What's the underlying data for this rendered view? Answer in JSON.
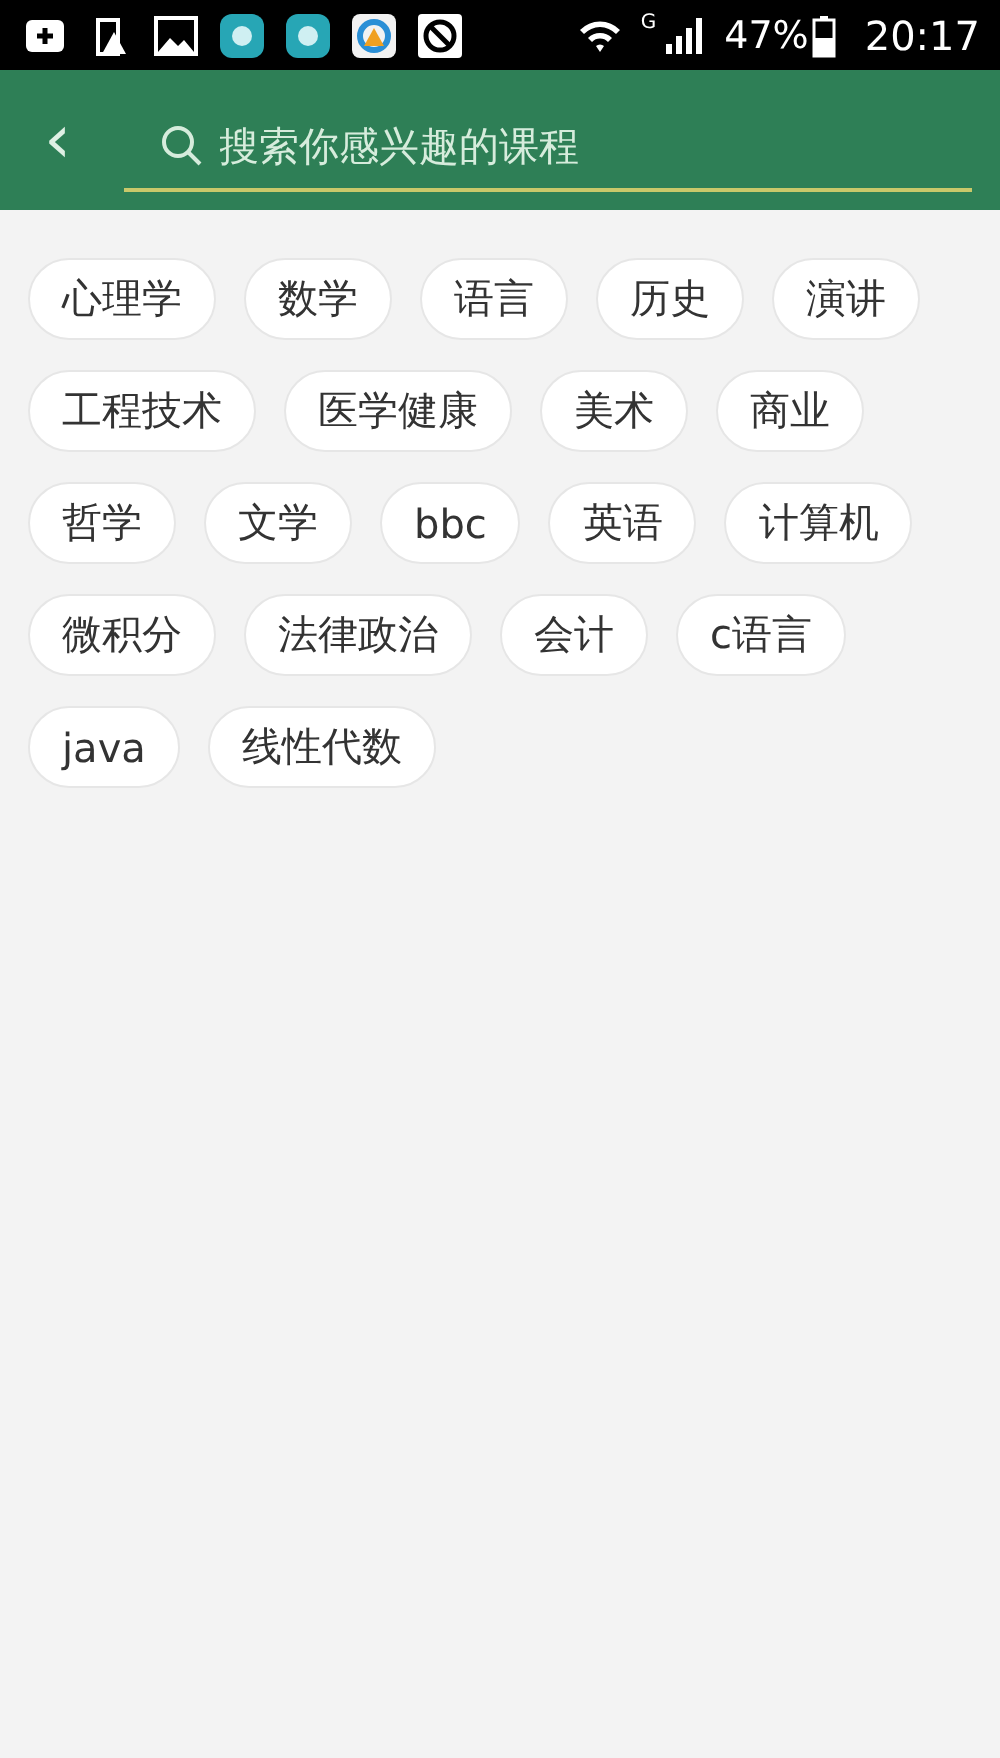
{
  "status_bar": {
    "network": "G",
    "battery": "47%",
    "time": "20:17"
  },
  "header": {
    "back": "‹",
    "search": {
      "placeholder": "搜索你感兴趣的课程"
    }
  },
  "tags": [
    {
      "label": "心理学"
    },
    {
      "label": "数学"
    },
    {
      "label": "语言"
    },
    {
      "label": "历史"
    },
    {
      "label": "演讲"
    },
    {
      "label": "工程技术"
    },
    {
      "label": "医学健康"
    },
    {
      "label": "美术"
    },
    {
      "label": "商业"
    },
    {
      "label": "哲学"
    },
    {
      "label": "文学"
    },
    {
      "label": "bbc"
    },
    {
      "label": "英语"
    },
    {
      "label": "计算机"
    },
    {
      "label": "微积分"
    },
    {
      "label": "法律政治"
    },
    {
      "label": "会计"
    },
    {
      "label": "c语言"
    },
    {
      "label": "java"
    },
    {
      "label": "线性代数"
    }
  ]
}
